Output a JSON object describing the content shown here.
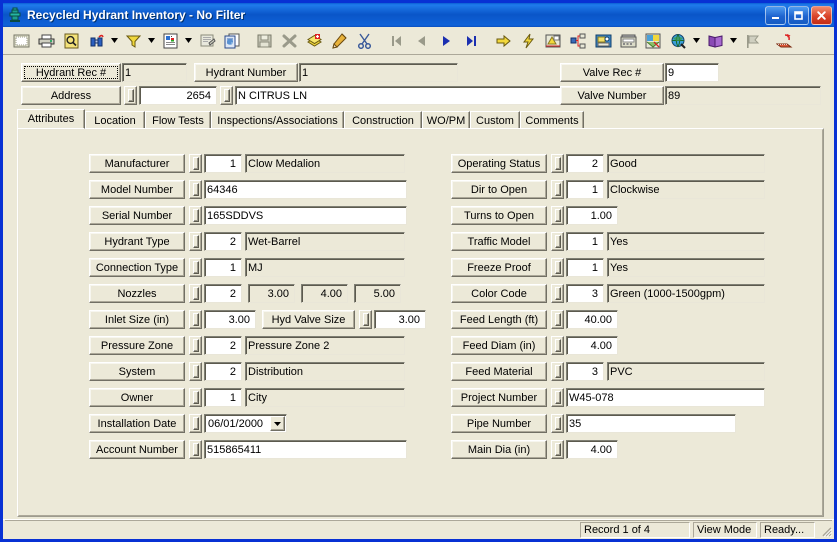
{
  "window": {
    "title": "Recycled Hydrant Inventory - No Filter",
    "icon": "hydrant-icon",
    "accent_titlebar": "#0a55c8",
    "face_color": "#ece9d8",
    "frame_color": "#0831d4",
    "caption_buttons": [
      {
        "name": "minimize",
        "glyph": "_"
      },
      {
        "name": "maximize",
        "glyph": "[]"
      },
      {
        "name": "close",
        "glyph": "X"
      }
    ]
  },
  "toolbar": {
    "buttons": [
      {
        "name": "print-preview-icon",
        "label": "Print Preview"
      },
      {
        "name": "print-icon",
        "label": "Print"
      },
      {
        "name": "search-page-icon",
        "label": "Find"
      },
      {
        "name": "binoculars-icon",
        "label": "Search"
      },
      {
        "name": "dropdown-arrow-1",
        "label": ""
      },
      {
        "name": "filter-funnel-icon",
        "label": "Filter"
      },
      {
        "name": "dropdown-arrow-2",
        "label": ""
      },
      {
        "name": "report-icon",
        "label": "Report"
      },
      {
        "name": "dropdown-arrow-3",
        "label": ""
      },
      {
        "name": "form-design-icon",
        "label": "Form Design"
      },
      {
        "name": "copy-record-icon",
        "label": "Copy Record"
      },
      {
        "name": "separator-1",
        "label": ""
      },
      {
        "name": "save-icon",
        "label": "Save"
      },
      {
        "name": "delete-icon",
        "label": "Delete"
      },
      {
        "name": "new-record-icon",
        "label": "New Record"
      },
      {
        "name": "edit-pencil-icon",
        "label": "Edit"
      },
      {
        "name": "cut-scissors-icon",
        "label": "Cut"
      },
      {
        "name": "separator-2",
        "label": ""
      },
      {
        "name": "first-record-icon",
        "label": "First Record"
      },
      {
        "name": "prev-record-icon",
        "label": "Previous Record"
      },
      {
        "name": "next-record-icon",
        "label": "Next Record"
      },
      {
        "name": "last-record-icon",
        "label": "Last Record"
      },
      {
        "name": "separator-3",
        "label": ""
      },
      {
        "name": "goto-icon",
        "label": "Go To"
      },
      {
        "name": "lightning-icon",
        "label": "Quick Action"
      },
      {
        "name": "map-icon",
        "label": "Map"
      },
      {
        "name": "tree-view-icon",
        "label": "Tree View"
      },
      {
        "name": "workorder-icon",
        "label": "Work Order"
      },
      {
        "name": "phone-icon",
        "label": "Phone"
      },
      {
        "name": "gis-icon",
        "label": "GIS"
      },
      {
        "name": "globe-search-icon",
        "label": "Web Search"
      },
      {
        "name": "dropdown-arrow-4",
        "label": ""
      },
      {
        "name": "book-icon",
        "label": "Library"
      },
      {
        "name": "dropdown-arrow-5",
        "label": ""
      },
      {
        "name": "flag-icon",
        "label": "Flag"
      },
      {
        "name": "separator-4",
        "label": ""
      },
      {
        "name": "recycle-icon",
        "label": "Recycle"
      }
    ]
  },
  "header": {
    "hydrant_rec_label": "Hydrant Rec #",
    "hydrant_rec_value": "1",
    "hydrant_number_label": "Hydrant Number",
    "hydrant_number_value": "1",
    "valve_rec_label": "Valve Rec #",
    "valve_rec_value": "9",
    "valve_number_label": "Valve Number",
    "valve_number_value": "89",
    "address_label": "Address",
    "address_number": "2654",
    "address_street": "N CITRUS LN"
  },
  "tabs": [
    {
      "label": "Attributes",
      "active": true
    },
    {
      "label": "Location",
      "active": false
    },
    {
      "label": "Flow Tests",
      "active": false
    },
    {
      "label": "Inspections/Associations",
      "active": false
    },
    {
      "label": "Construction",
      "active": false
    },
    {
      "label": "WO/PM",
      "active": false
    },
    {
      "label": "Custom",
      "active": false
    },
    {
      "label": "Comments",
      "active": false
    }
  ],
  "left_fields": [
    {
      "label": "Manufacturer",
      "code": "1",
      "desc": "Clow Medalion"
    },
    {
      "label": "Model Number",
      "text": "64346"
    },
    {
      "label": "Serial Number",
      "text": "165SDDVS"
    },
    {
      "label": "Hydrant Type",
      "code": "2",
      "desc": "Wet-Barrel"
    },
    {
      "label": "Connection Type",
      "code": "1",
      "desc": "MJ"
    },
    {
      "label": "Nozzles",
      "code": "2",
      "sizes": [
        "3.00",
        "4.00",
        "5.00"
      ]
    },
    {
      "label": "Inlet Size (in)",
      "num": "3.00",
      "label2": "Hyd Valve Size",
      "num2": "3.00"
    },
    {
      "label": "Pressure Zone",
      "code": "2",
      "desc": "Pressure Zone 2"
    },
    {
      "label": "System",
      "code": "2",
      "desc": "Distribution"
    },
    {
      "label": "Owner",
      "code": "1",
      "desc": "City"
    },
    {
      "label": "Installation Date",
      "date": "06/01/2000"
    },
    {
      "label": "Account Number",
      "text": "515865411"
    }
  ],
  "right_fields": [
    {
      "label": "Operating Status",
      "code": "2",
      "desc": "Good"
    },
    {
      "label": "Dir to Open",
      "code": "1",
      "desc": "Clockwise"
    },
    {
      "label": "Turns to Open",
      "num": "1.00"
    },
    {
      "label": "Traffic Model",
      "code": "1",
      "desc": "Yes"
    },
    {
      "label": "Freeze Proof",
      "code": "1",
      "desc": "Yes"
    },
    {
      "label": "Color Code",
      "code": "3",
      "desc": "Green (1000-1500gpm)"
    },
    {
      "label": "Feed Length (ft)",
      "num": "40.00"
    },
    {
      "label": "Feed Diam (in)",
      "num": "4.00"
    },
    {
      "label": "Feed Material",
      "code": "3",
      "desc": "PVC"
    },
    {
      "label": "Project Number",
      "text": "W45-078"
    },
    {
      "label": "Pipe Number",
      "text": "35"
    },
    {
      "label": "Main Dia (in)",
      "num": "4.00"
    }
  ],
  "statusbar": {
    "record": "Record 1 of 4",
    "mode": "View Mode",
    "state": "Ready..."
  }
}
